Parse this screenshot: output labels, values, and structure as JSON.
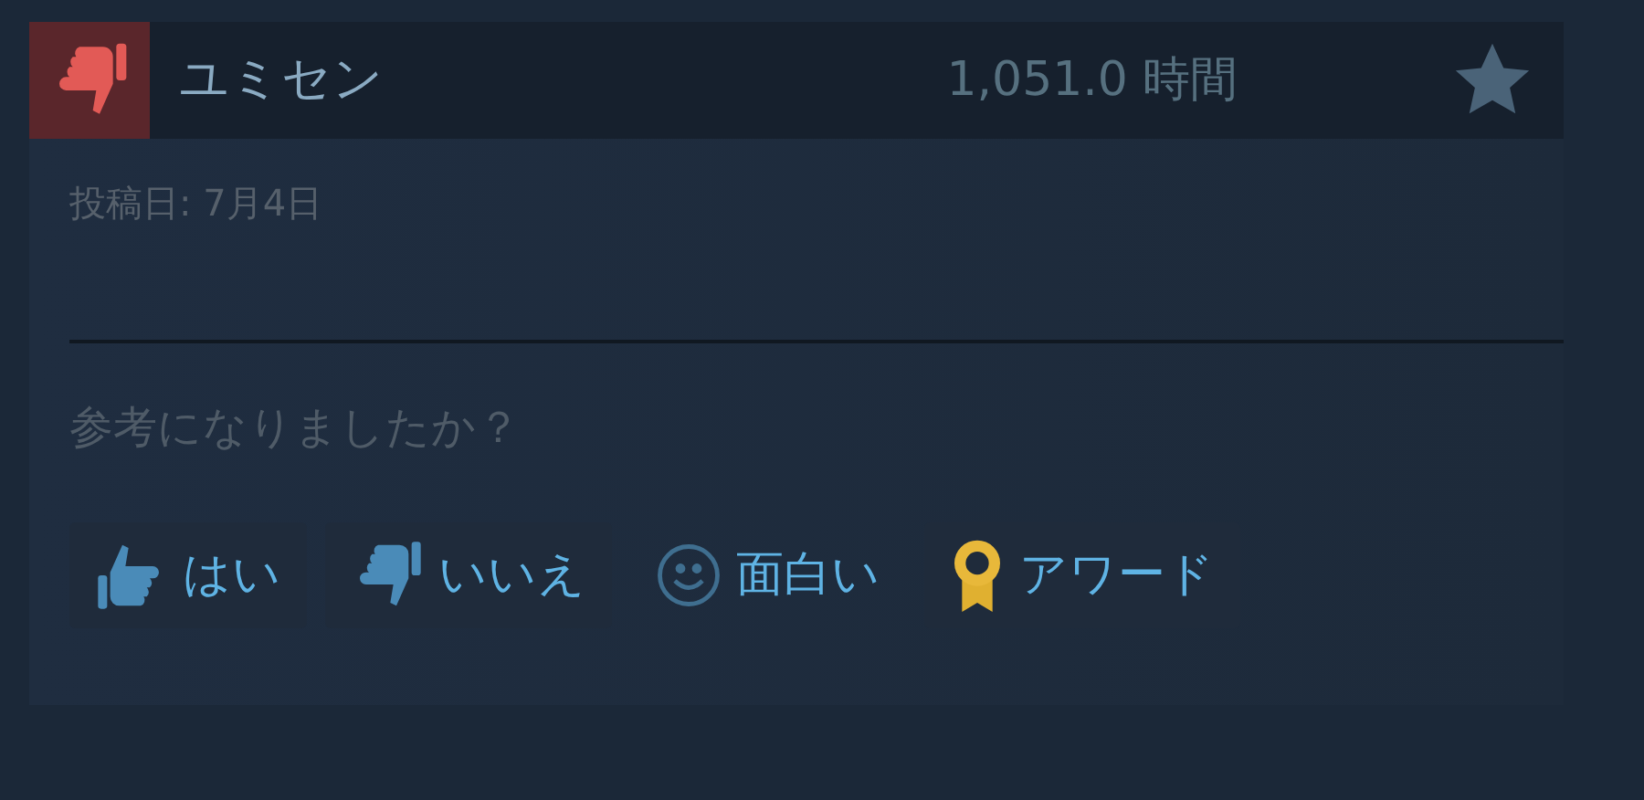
{
  "review": {
    "recommended": false,
    "author": "ユミセン",
    "hours": "1,051.0 時間",
    "posted": "投稿日: 7月4日"
  },
  "helpful": {
    "question": "参考になりましたか？",
    "buttons": [
      {
        "kind": "yes",
        "label": "はい"
      },
      {
        "kind": "no",
        "label": "いいえ"
      },
      {
        "kind": "funny",
        "label": "面白い"
      },
      {
        "kind": "award",
        "label": "アワード"
      }
    ]
  }
}
